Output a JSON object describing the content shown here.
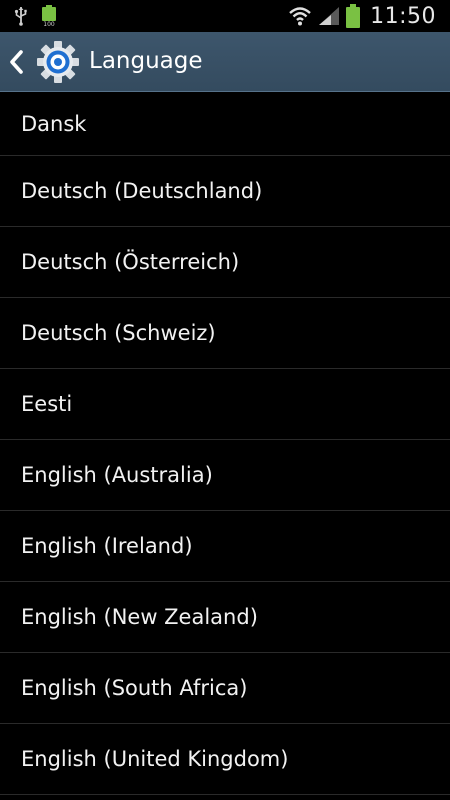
{
  "status_bar": {
    "time": "11:50",
    "icons": [
      "usb-icon",
      "battery-full-notification-icon",
      "wifi-icon",
      "signal-icon",
      "battery-icon"
    ],
    "battery_color": "#7ac143"
  },
  "action_bar": {
    "title": "Language",
    "back_icon": "chevron-left-icon",
    "app_icon": "settings-gear-icon",
    "background": "#3d566c"
  },
  "languages": [
    {
      "label": "Dansk"
    },
    {
      "label": "Deutsch (Deutschland)"
    },
    {
      "label": "Deutsch (Österreich)"
    },
    {
      "label": "Deutsch (Schweiz)"
    },
    {
      "label": "Eesti"
    },
    {
      "label": "English (Australia)"
    },
    {
      "label": "English (Ireland)"
    },
    {
      "label": "English (New Zealand)"
    },
    {
      "label": "English (South Africa)"
    },
    {
      "label": "English (United Kingdom)"
    }
  ]
}
